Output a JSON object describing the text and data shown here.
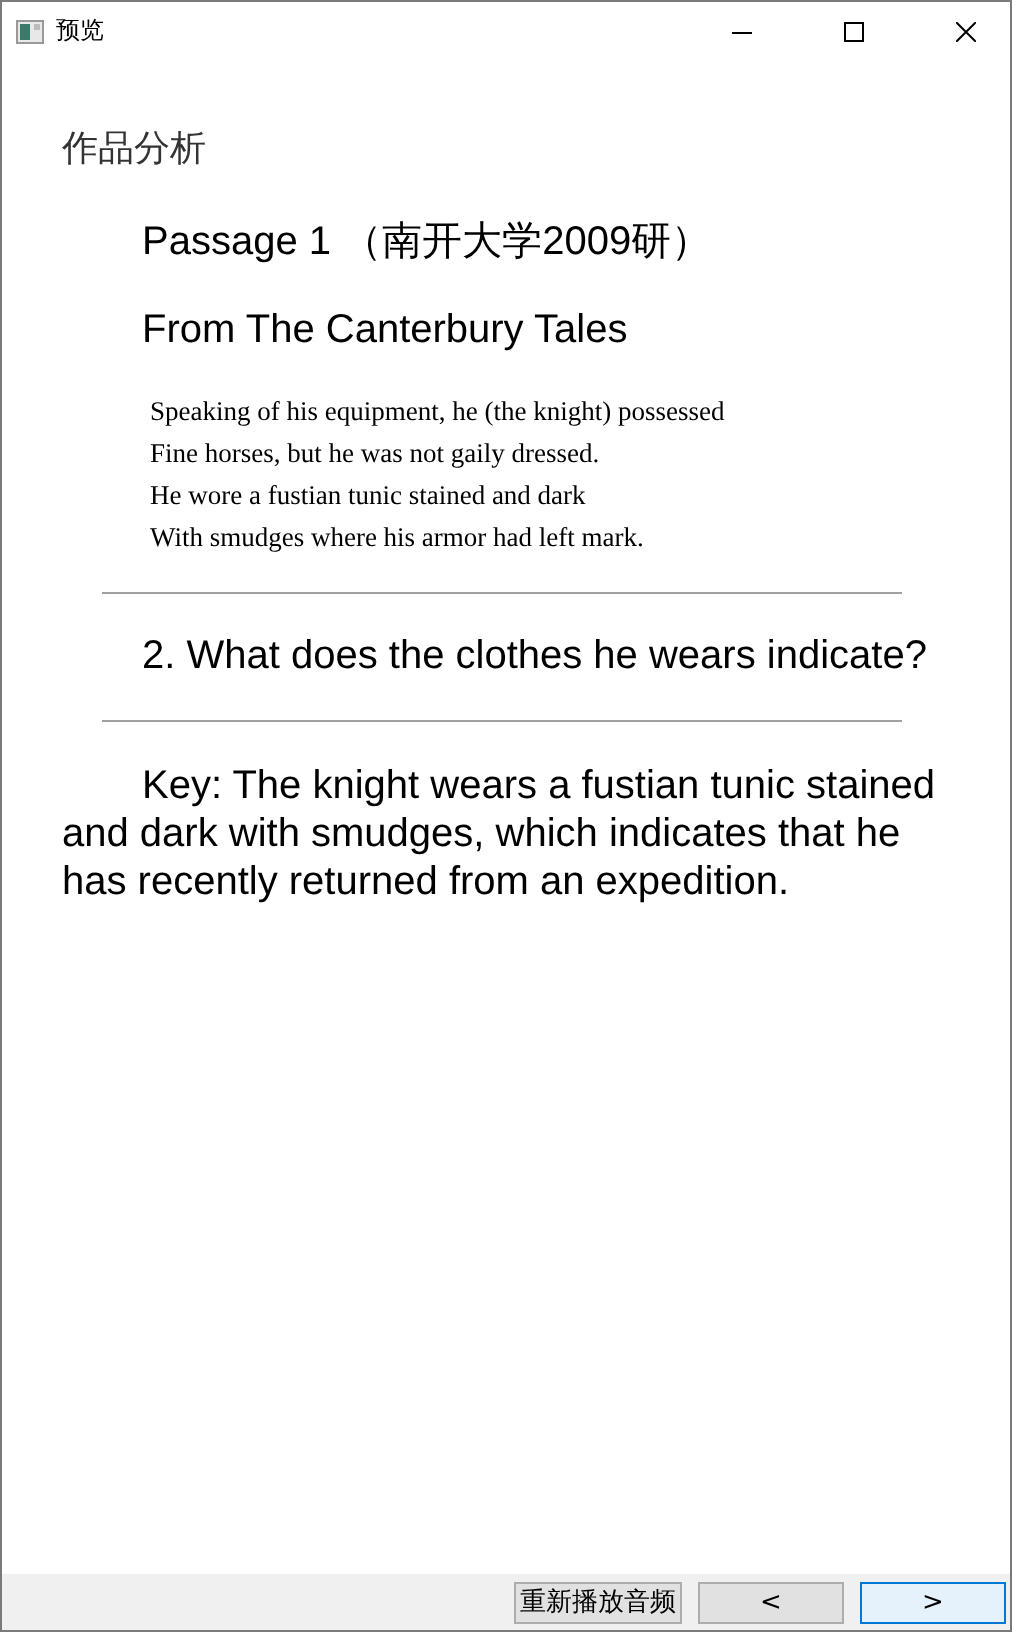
{
  "window": {
    "title": "预览"
  },
  "section_title": "作品分析",
  "passage_title": "Passage 1 （南开大学2009研）",
  "source": "From The Canterbury Tales",
  "poem_lines": [
    "Speaking of his equipment, he (the knight) possessed",
    "Fine horses, but he was not gaily dressed.",
    "He wore a fustian tunic stained and dark",
    "With smudges where his armor had left mark."
  ],
  "question": "2. What does the clothes he wears indicate?",
  "answer": "Key: The knight wears a fustian tunic stained and dark with smudges, which indicates that he has recently returned from an expedition.",
  "buttons": [
    {
      "kind": "replay",
      "label": "重新播放音频",
      "focused": false
    },
    {
      "kind": "prev",
      "label": "<",
      "focused": false
    },
    {
      "kind": "next",
      "label": ">",
      "focused": true
    }
  ]
}
